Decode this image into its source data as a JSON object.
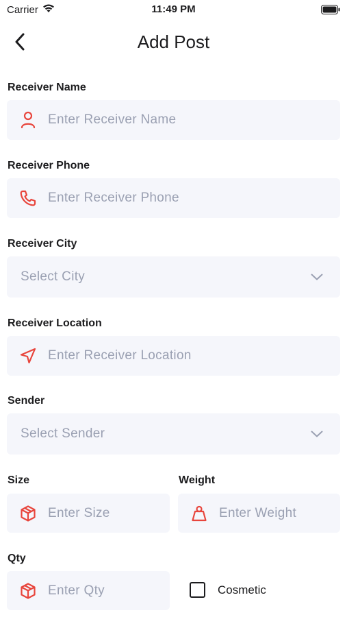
{
  "status_bar": {
    "carrier": "Carrier",
    "time": "11:49 PM"
  },
  "nav": {
    "title": "Add Post"
  },
  "form": {
    "receiver_name": {
      "label": "Receiver Name",
      "placeholder": "Enter Receiver Name",
      "icon": "person-icon"
    },
    "receiver_phone": {
      "label": "Receiver Phone",
      "placeholder": "Enter Receiver Phone",
      "icon": "phone-icon"
    },
    "receiver_city": {
      "label": "Receiver City",
      "placeholder": "Select City"
    },
    "receiver_location": {
      "label": "Receiver Location",
      "placeholder": "Enter Receiver Location",
      "icon": "navigation-icon"
    },
    "sender": {
      "label": "Sender",
      "placeholder": "Select Sender"
    },
    "size": {
      "label": "Size",
      "placeholder": "Enter Size",
      "icon": "box-icon"
    },
    "weight": {
      "label": "Weight",
      "placeholder": "Enter Weight",
      "icon": "weight-icon"
    },
    "qty": {
      "label": "Qty",
      "placeholder": "Enter Qty",
      "icon": "box-icon"
    },
    "cosmetic": {
      "label": "Cosmetic",
      "checked": false
    }
  },
  "colors": {
    "accent": "#e8453c",
    "input_bg": "#f5f6fb",
    "placeholder": "#9aa0b2"
  }
}
